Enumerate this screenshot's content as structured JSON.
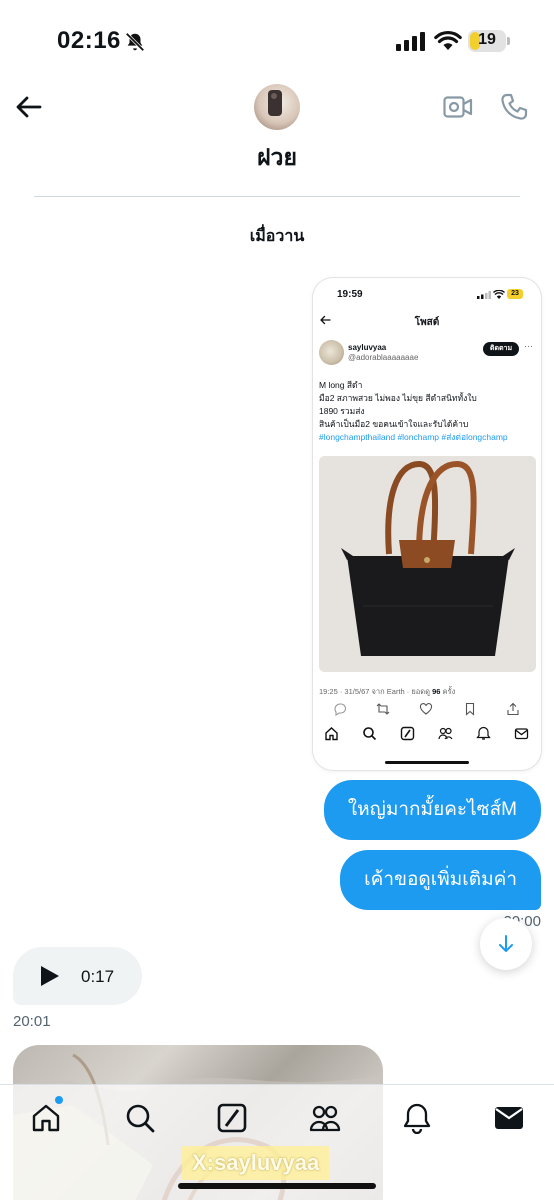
{
  "status_bar": {
    "time": "02:16",
    "battery": "19"
  },
  "header": {
    "contact_name": "ฝวย"
  },
  "day_label": "เมื่อวาน",
  "shared_post": {
    "time": "19:59",
    "battery": "23",
    "title": "โพสต์",
    "user_name": "sayluvyaa",
    "user_handle": "@adorablaaaaaaae",
    "follow_label": "ติดตาม",
    "text_lines": [
      "M long สีดำ",
      "มือ2 สภาพสวย ไม่พอง ไม่ขุย สีดำสนิททั้งใบ",
      "1890 รวมส่ง",
      "สินค้าเป็นมือ2 ขอคนเข้าใจและรับได้ค้าบ"
    ],
    "hashtags": "#longchampthailand #lonchamp #ส่งต่อlongchamp",
    "meta_prefix": "19:25 · 31/5/67 จาก Earth · ยอดดู ",
    "meta_views": "96",
    "meta_suffix": " ครั้ง"
  },
  "messages": {
    "sent_1": "ใหญ่มากมั้ยคะไซส์M",
    "sent_2": "เค้าขอดูเพิ่มเติมค่า",
    "sent_time": "20:00",
    "voice_duration": "0:17",
    "received_time": "20:01"
  },
  "watermark": "X:sayluvyaa",
  "icons": {
    "back": "back-arrow-icon",
    "video": "video-call-icon",
    "phone": "phone-icon",
    "home": "home-icon",
    "search": "search-icon",
    "grok": "grok-icon",
    "communities": "communities-icon",
    "notifications": "bell-icon",
    "messages": "mail-icon"
  },
  "colors": {
    "accent": "#1d9bf0",
    "bubble_received": "#eff3f4",
    "text": "#0f1419",
    "muted": "#536471"
  }
}
